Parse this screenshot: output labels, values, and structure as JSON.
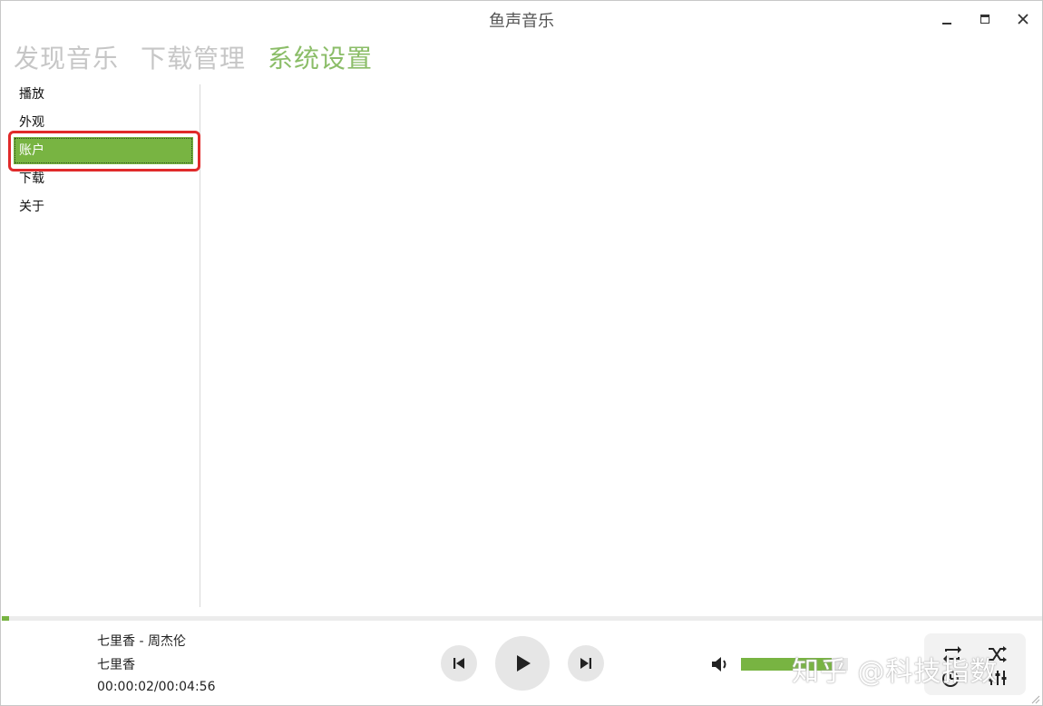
{
  "window": {
    "title": "鱼声音乐"
  },
  "nav": {
    "tabs": [
      {
        "label": "发现音乐",
        "active": false
      },
      {
        "label": "下载管理",
        "active": false
      },
      {
        "label": "系统设置",
        "active": true
      }
    ]
  },
  "sidebar": {
    "items": [
      {
        "label": "播放",
        "selected": false
      },
      {
        "label": "外观",
        "selected": false
      },
      {
        "label": "账户",
        "selected": true
      },
      {
        "label": "下载",
        "selected": false
      },
      {
        "label": "关于",
        "selected": false
      }
    ]
  },
  "player": {
    "song_title": "七里香 - 周杰伦",
    "album": "七里香",
    "time": "00:00:02/00:04:56",
    "progress_fraction": 0.007,
    "volume_fraction": 0.85
  },
  "watermark": "知乎 @科技指数",
  "colors": {
    "accent": "#78b442",
    "tab_active": "#8bbd68",
    "tab_inactive": "#c6c6c6",
    "highlight": "#e02a2a"
  }
}
